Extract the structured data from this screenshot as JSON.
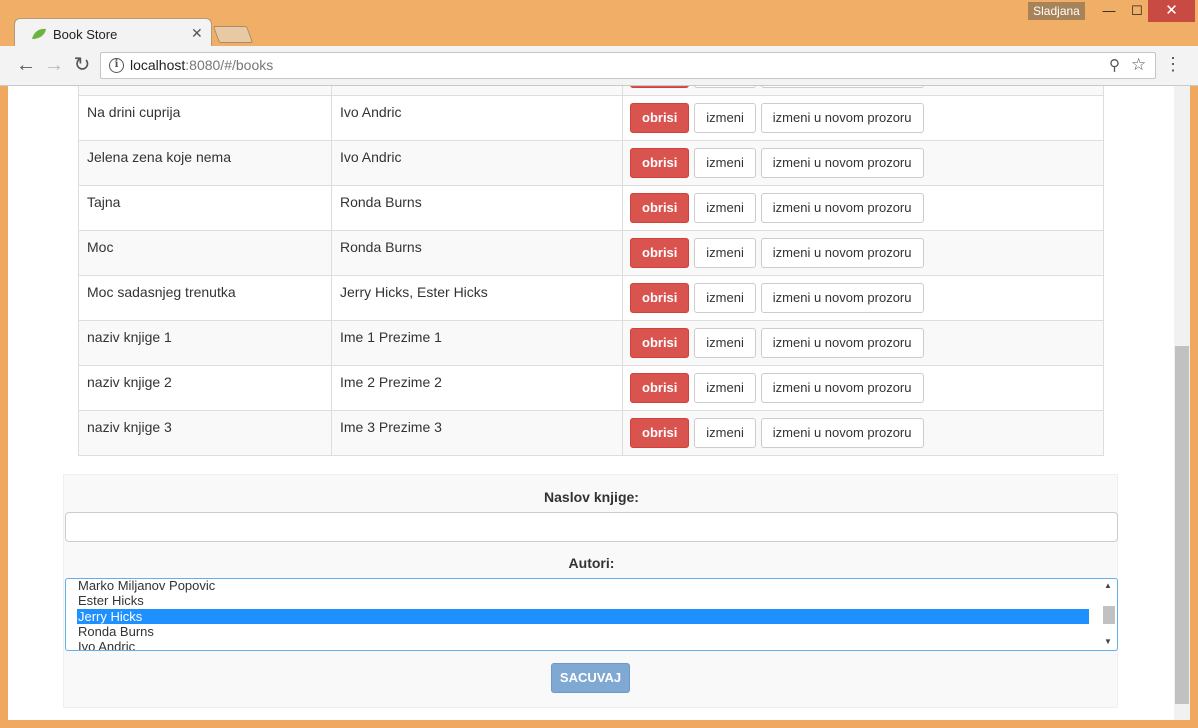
{
  "window": {
    "user": "Sladjana",
    "minimize": "—",
    "maximize": "☐",
    "close": "✕"
  },
  "tab": {
    "title": "Book Store",
    "close": "✕"
  },
  "toolbar": {
    "back": "←",
    "forward": "→",
    "reload": "↻",
    "url_host": "localhost",
    "url_rest": ":8080/#/books",
    "zoom_icon": "⚲",
    "star_icon": "☆",
    "menu_icon": "⋮"
  },
  "books": {
    "delete_label": "obrisi",
    "edit_label": "izmeni",
    "edit_new_window_label": "izmeni u novom prozoru",
    "rows": [
      {
        "title": "",
        "authors": ""
      },
      {
        "title": "Na drini cuprija",
        "authors": "Ivo Andric"
      },
      {
        "title": "Jelena zena koje nema",
        "authors": "Ivo Andric"
      },
      {
        "title": "Tajna",
        "authors": "Ronda Burns"
      },
      {
        "title": "Moc",
        "authors": "Ronda Burns"
      },
      {
        "title": "Moc sadasnjeg trenutka",
        "authors": "Jerry Hicks, Ester Hicks"
      },
      {
        "title": "naziv knjige 1",
        "authors": "Ime 1 Prezime 1"
      },
      {
        "title": "naziv knjige 2",
        "authors": "Ime 2 Prezime 2"
      },
      {
        "title": "naziv knjige 3",
        "authors": "Ime 3 Prezime 3"
      }
    ]
  },
  "form": {
    "title_label": "Naslov knjige:",
    "title_value": "",
    "authors_label": "Autori:",
    "authors_options": [
      "Marko Miljanov Popovic",
      "Ester Hicks",
      "Jerry Hicks",
      "Ronda Burns",
      "Ivo Andric"
    ],
    "authors_selected": "Jerry Hicks",
    "save_label": "SACUVAJ"
  }
}
